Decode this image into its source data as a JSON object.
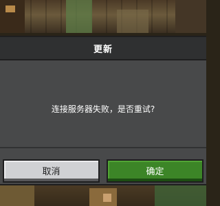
{
  "dialog": {
    "title": "更新",
    "message": "连接服务器失败，是否重试?",
    "cancel_label": "取消",
    "confirm_label": "确定"
  },
  "colors": {
    "dialog_background": "#48494a",
    "header_background": "#2f3031",
    "cancel_button": "#d0d1d4",
    "confirm_button": "#3c8527"
  }
}
